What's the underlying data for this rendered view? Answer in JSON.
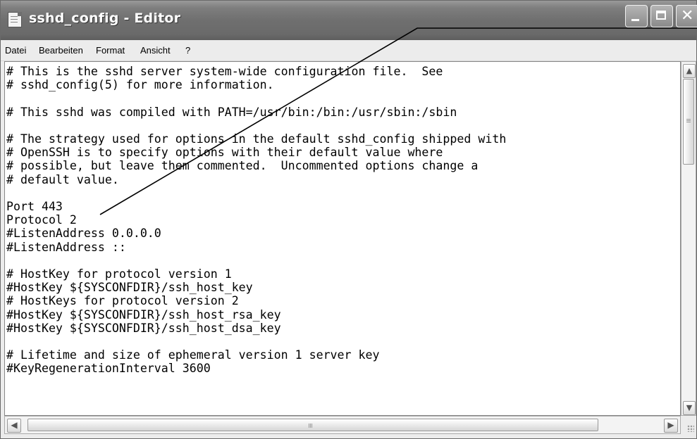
{
  "window": {
    "title": "sshd_config - Editor",
    "icon": "notepad-icon"
  },
  "title_buttons": {
    "minimize": "minimize-icon",
    "maximize": "maximize-icon",
    "close": "close-icon",
    "close_glyph": "✕"
  },
  "menu": [
    {
      "label": "Datei"
    },
    {
      "label": "Bearbeiten"
    },
    {
      "label": "Format"
    },
    {
      "label": "Ansicht"
    },
    {
      "label": "?"
    }
  ],
  "editor": {
    "content": "# This is the sshd server system-wide configuration file.  See\n# sshd_config(5) for more information.\n\n# This sshd was compiled with PATH=/usr/bin:/bin:/usr/sbin:/sbin\n\n# The strategy used for options in the default sshd_config shipped with\n# OpenSSH is to specify options with their default value where\n# possible, but leave them commented.  Uncommented options change a\n# default value.\n\nPort 443\nProtocol 2\n#ListenAddress 0.0.0.0\n#ListenAddress ::\n\n# HostKey for protocol version 1\n#HostKey ${SYSCONFDIR}/ssh_host_key\n# HostKeys for protocol version 2\n#HostKey ${SYSCONFDIR}/ssh_host_rsa_key\n#HostKey ${SYSCONFDIR}/ssh_host_dsa_key\n\n# Lifetime and size of ephemeral version 1 server key\n#KeyRegenerationInterval 3600"
  },
  "scrollbars": {
    "up_arrow": "▲",
    "down_arrow": "▼",
    "left_arrow": "◀",
    "right_arrow": "▶"
  },
  "annotation": {
    "type": "callout-line"
  }
}
